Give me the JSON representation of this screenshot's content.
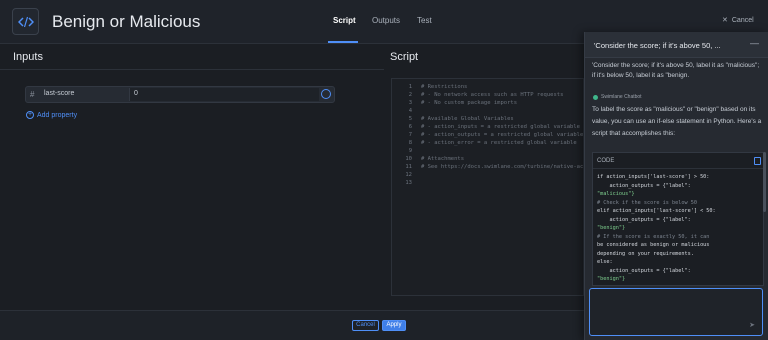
{
  "header": {
    "title": "Benign or Malicious",
    "tabs": [
      {
        "label": "Script",
        "active": true
      },
      {
        "label": "Outputs",
        "active": false
      },
      {
        "label": "Test",
        "active": false
      }
    ],
    "cancel_label": "Cancel"
  },
  "inputs": {
    "title": "Inputs",
    "property": {
      "name": "last-score",
      "value": "0"
    },
    "add_property_label": "Add property"
  },
  "script": {
    "title": "Script",
    "line_numbers": [
      "1",
      "2",
      "3",
      "4",
      "5",
      "6",
      "7",
      "8",
      "9",
      "10",
      "11",
      "12",
      "13"
    ],
    "lines": [
      "# Restrictions",
      "# - No network access such as HTTP requests",
      "# - No custom package imports",
      "",
      "# Available Global Variables",
      "# - action_inputs = a restricted global variable",
      "# - action_outputs = a restricted global variable",
      "# - action_error = a restricted global variable",
      "",
      "# Attachments",
      "# See https://docs.swimlane.com/turbine/native-actions",
      "",
      ""
    ]
  },
  "footer": {
    "cancel_label": "Cancel",
    "apply_label": "Apply"
  },
  "chat": {
    "header_title": "'Consider the score; if it's above 50, ...",
    "minimize_icon": "minus-icon",
    "user_message": "'Consider the score; if it's above 50, label it as \"malicious\"; if it's below 50, label it as \"benign.",
    "bot_name": "Swimlane Chatbot",
    "bot_message": "To label the score as \"malicious\" or \"benign\" based on its value, you can use an if-else statement in Python. Here's a script that accomplishes this:",
    "code_label": "CODE",
    "code_lines": [
      "if action_inputs['last-score'] > 50:",
      "    action_outputs = {\"label\":",
      "\"malicious\"}",
      "# Check if the score is below 50",
      "elif action_inputs['last-score'] < 50:",
      "    action_outputs = {\"label\":",
      "\"benign\"}",
      "# If the score is exactly 50, it can",
      "be considered as benign or malicious",
      "depending on your requirements.",
      "else:",
      "    action_outputs = {\"label\":",
      "\"benign\"}"
    ]
  },
  "colors": {
    "accent": "#4f8ff7",
    "background": "#1b1e23",
    "panel": "#262a31"
  }
}
